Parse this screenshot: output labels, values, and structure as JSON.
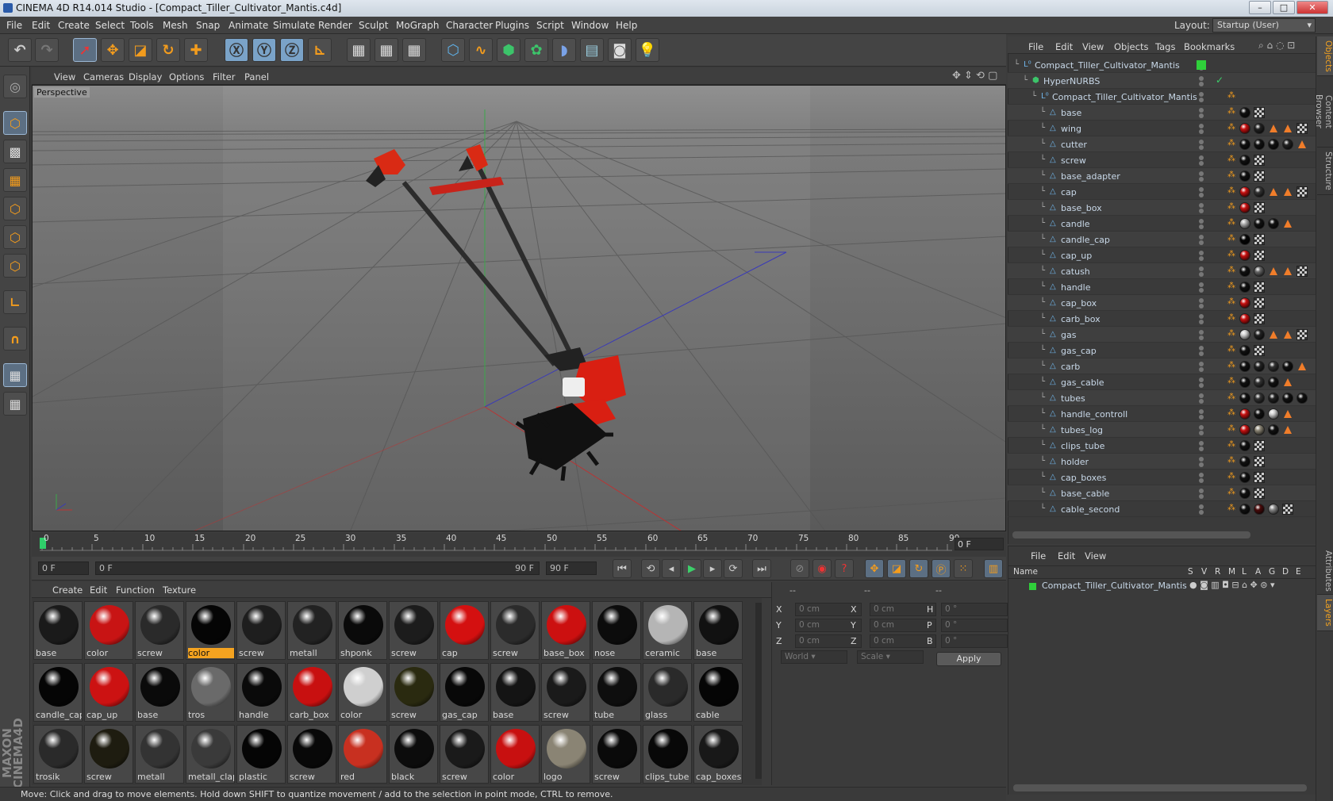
{
  "window": {
    "title": "CINEMA 4D R14.014 Studio - [Compact_Tiller_Cultivator_Mantis.c4d]"
  },
  "menu": [
    "File",
    "Edit",
    "Create",
    "Select",
    "Tools",
    "Mesh",
    "Snap",
    "Animate",
    "Simulate",
    "Render",
    "Sculpt",
    "MoGraph",
    "Character",
    "Plugins",
    "Script",
    "Window",
    "Help"
  ],
  "layout": {
    "label": "Layout:",
    "value": "Startup (User)"
  },
  "viewport": {
    "menu": [
      "View",
      "Cameras",
      "Display",
      "Options",
      "Filter",
      "Panel"
    ],
    "label": "Perspective"
  },
  "timeline": {
    "ticks": [
      "0",
      "5",
      "10",
      "15",
      "20",
      "25",
      "30",
      "35",
      "40",
      "45",
      "50",
      "55",
      "60",
      "65",
      "70",
      "75",
      "80",
      "85",
      "90"
    ],
    "current": "0 F",
    "start": "0 F",
    "range_start": "0 F",
    "range_end": "90 F",
    "end": "90 F"
  },
  "material_menu": [
    "Create",
    "Edit",
    "Function",
    "Texture"
  ],
  "materials": [
    {
      "name": "base",
      "color": "#1a1a1a"
    },
    {
      "name": "color",
      "color": "#c81414"
    },
    {
      "name": "screw",
      "color": "#2a2a2a"
    },
    {
      "name": "color",
      "color": "#050505",
      "selected": true
    },
    {
      "name": "screw",
      "color": "#1e1e1e"
    },
    {
      "name": "metall",
      "color": "#222222"
    },
    {
      "name": "shponk",
      "color": "#0a0a0a"
    },
    {
      "name": "screw",
      "color": "#1c1c1c"
    },
    {
      "name": "cap",
      "color": "#d41010"
    },
    {
      "name": "screw",
      "color": "#2b2b2b"
    },
    {
      "name": "base_box",
      "color": "#cc1010"
    },
    {
      "name": "nose",
      "color": "#0c0c0c"
    },
    {
      "name": "ceramic",
      "color": "#b5b5b5"
    },
    {
      "name": "base",
      "color": "#111111"
    },
    {
      "name": "candle_cap",
      "color": "#050505"
    },
    {
      "name": "cap_up",
      "color": "#cc1212"
    },
    {
      "name": "base",
      "color": "#0a0a0a"
    },
    {
      "name": "tros",
      "color": "#6a6a6a"
    },
    {
      "name": "handle",
      "color": "#0a0a0a"
    },
    {
      "name": "carb_box",
      "color": "#c81010"
    },
    {
      "name": "color",
      "color": "#cfcfcf"
    },
    {
      "name": "screw",
      "color": "#2a2a10"
    },
    {
      "name": "gas_cap",
      "color": "#080808"
    },
    {
      "name": "base",
      "color": "#141414"
    },
    {
      "name": "screw",
      "color": "#1a1a1a"
    },
    {
      "name": "tube",
      "color": "#0e0e0e"
    },
    {
      "name": "glass",
      "color": "#2a2a2a"
    },
    {
      "name": "cable",
      "color": "#050505"
    },
    {
      "name": "trosik",
      "color": "#2a2a2a"
    },
    {
      "name": "screw",
      "color": "#1e1c10"
    },
    {
      "name": "metall",
      "color": "#333333"
    },
    {
      "name": "metall_clap",
      "color": "#3a3a3a"
    },
    {
      "name": "plastic",
      "color": "#050505"
    },
    {
      "name": "screw",
      "color": "#080808"
    },
    {
      "name": "red",
      "color": "#c83020"
    },
    {
      "name": "black",
      "color": "#0c0c0c"
    },
    {
      "name": "screw",
      "color": "#1a1a1a"
    },
    {
      "name": "color",
      "color": "#c81010"
    },
    {
      "name": "logo",
      "color": "#8a8474"
    },
    {
      "name": "screw",
      "color": "#0a0a0a"
    },
    {
      "name": "clips_tube",
      "color": "#080808"
    },
    {
      "name": "cap_boxes",
      "color": "#181818"
    }
  ],
  "coords": {
    "header": [
      "--",
      "--",
      "--"
    ],
    "rows": [
      {
        "a": "X",
        "av": "0 cm",
        "b": "X",
        "bv": "0 cm",
        "c": "H",
        "cv": "0 °"
      },
      {
        "a": "Y",
        "av": "0 cm",
        "b": "Y",
        "bv": "0 cm",
        "c": "P",
        "cv": "0 °"
      },
      {
        "a": "Z",
        "av": "0 cm",
        "b": "Z",
        "bv": "0 cm",
        "c": "B",
        "cv": "0 °"
      }
    ],
    "mode1": "World",
    "mode2": "Scale",
    "apply": "Apply"
  },
  "status": "Move: Click and drag to move elements. Hold down SHIFT to quantize movement / add to the selection in point mode, CTRL to remove.",
  "objects": {
    "menu": [
      "File",
      "Edit",
      "View",
      "Objects",
      "Tags",
      "Bookmarks"
    ],
    "root": "Compact_Tiller_Cultivator_Mantis",
    "hypernurbs": "HyperNURBS",
    "group": "Compact_Tiller_Cultivator_Mantis",
    "items": [
      {
        "name": "base",
        "tags": [
          "#111",
          "chk"
        ]
      },
      {
        "name": "wing",
        "tags": [
          "#c81010",
          "#222",
          "tri",
          "tri",
          "chk"
        ]
      },
      {
        "name": "cutter",
        "tags": [
          "#111",
          "#111",
          "#111",
          "#222",
          "tri"
        ]
      },
      {
        "name": "screw",
        "tags": [
          "#111",
          "chk"
        ]
      },
      {
        "name": "base_adapter",
        "tags": [
          "#111",
          "chk"
        ]
      },
      {
        "name": "cap",
        "tags": [
          "#c81010",
          "#333",
          "tri",
          "tri",
          "chk"
        ]
      },
      {
        "name": "base_box",
        "tags": [
          "#c81010",
          "chk"
        ]
      },
      {
        "name": "candle",
        "tags": [
          "#aaa",
          "#111",
          "#111",
          "tri"
        ]
      },
      {
        "name": "candle_cap",
        "tags": [
          "#050505",
          "chk"
        ]
      },
      {
        "name": "cap_up",
        "tags": [
          "#c81010",
          "chk"
        ]
      },
      {
        "name": "catush",
        "tags": [
          "#111",
          "#666",
          "tri",
          "tri",
          "chk"
        ]
      },
      {
        "name": "handle",
        "tags": [
          "#111",
          "chk"
        ]
      },
      {
        "name": "cap_box",
        "tags": [
          "#c81010",
          "chk"
        ]
      },
      {
        "name": "carb_box",
        "tags": [
          "#c81010",
          "chk"
        ]
      },
      {
        "name": "gas",
        "tags": [
          "#ccc",
          "#222",
          "tri",
          "tri",
          "chk"
        ]
      },
      {
        "name": "gas_cap",
        "tags": [
          "#111",
          "chk"
        ]
      },
      {
        "name": "carb",
        "tags": [
          "#111",
          "#222",
          "#333",
          "#111",
          "tri"
        ]
      },
      {
        "name": "gas_cable",
        "tags": [
          "#111",
          "#333",
          "#111",
          "tri"
        ]
      },
      {
        "name": "tubes",
        "tags": [
          "#111",
          "#333",
          "#222",
          "#111",
          "#111"
        ]
      },
      {
        "name": "handle_controll",
        "tags": [
          "#c81010",
          "#111",
          "#ccc",
          "tri"
        ]
      },
      {
        "name": "tubes_log",
        "tags": [
          "#c81010",
          "#8a8474",
          "#111",
          "tri"
        ]
      },
      {
        "name": "clips_tube",
        "tags": [
          "#111",
          "chk"
        ]
      },
      {
        "name": "holder",
        "tags": [
          "#111",
          "chk"
        ]
      },
      {
        "name": "cap_boxes",
        "tags": [
          "#111",
          "chk"
        ]
      },
      {
        "name": "base_cable",
        "tags": [
          "#111",
          "chk"
        ]
      },
      {
        "name": "cable_second",
        "tags": [
          "#111",
          "#4a0a0a",
          "#888",
          "chk"
        ]
      }
    ]
  },
  "layers": {
    "menu": [
      "File",
      "Edit",
      "View"
    ],
    "columns": [
      "Name",
      "S",
      "V",
      "R",
      "M",
      "L",
      "A",
      "G",
      "D",
      "E"
    ],
    "row": "Compact_Tiller_Cultivator_Mantis"
  },
  "side_tabs": [
    "Objects",
    "Content Browser",
    "Structure",
    "Attributes",
    "Layers"
  ]
}
